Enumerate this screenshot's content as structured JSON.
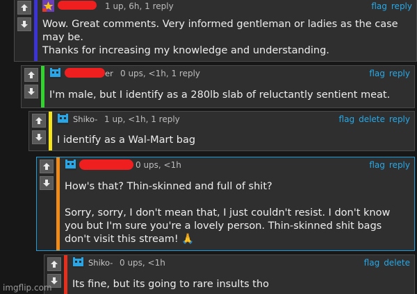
{
  "colors": {
    "page_bg": "#171717",
    "card_bg": "#2f2f2f",
    "link": "#27a9e8",
    "bar_blue": "#3b33d6",
    "bar_green": "#32d22f",
    "bar_yellow": "#f5e31b",
    "bar_orange": "#f08a18",
    "bar_red": "#e6301e",
    "redaction": "#ef1f1f"
  },
  "comments": [
    {
      "stats": "1 up, 6h, 1 reply",
      "actions": [
        "flag",
        "reply"
      ],
      "text": "Wow. Great comments. Very informed gentleman or ladies as the case may be.\nThanks for increasing my knowledge and understanding."
    },
    {
      "username_visible": "er",
      "stats": "0 ups, <1h, 1 reply",
      "actions": [
        "flag",
        "reply"
      ],
      "text": "I'm male, but I identify as a 280lb slab of reluctantly sentient meat."
    },
    {
      "username": "Shiko-",
      "stats": "1 up, <1h, 1 reply",
      "actions": [
        "flag",
        "delete",
        "reply"
      ],
      "text": "I identify as a Wal-Mart bag"
    },
    {
      "stats": "0 ups, <1h",
      "actions": [
        "flag",
        "reply"
      ],
      "text": "How's that? Thin-skinned and full of shit?\n\nSorry, sorry, I don't mean that, I just couldn't resist. I don't know you but I'm sure you're a lovely person. Thin-skinned shit bags don't visit this stream! 🙏"
    },
    {
      "username": "Shiko-",
      "stats": "0 ups, <1h",
      "actions": [
        "flag",
        "delete"
      ],
      "text": "Its fine, but its going to rare insults tho"
    }
  ],
  "watermark": "imgflip.com"
}
